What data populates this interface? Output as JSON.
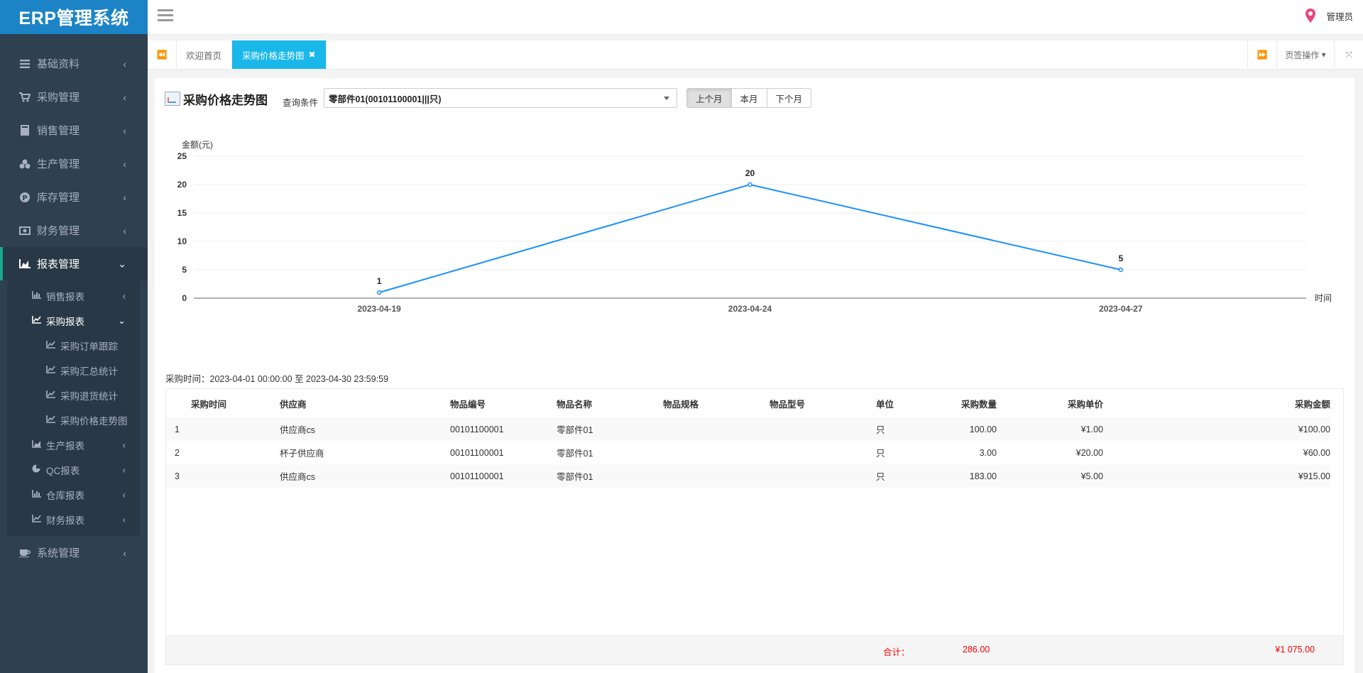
{
  "app": {
    "logo": "ERP管理系统",
    "user": "管理员"
  },
  "sidebar": {
    "items": [
      {
        "label": "基础资料",
        "icon": "list-icon"
      },
      {
        "label": "采购管理",
        "icon": "cart-icon"
      },
      {
        "label": "销售管理",
        "icon": "book-icon"
      },
      {
        "label": "生产管理",
        "icon": "cubes-icon"
      },
      {
        "label": "库存管理",
        "icon": "parking-icon"
      },
      {
        "label": "财务管理",
        "icon": "money-icon"
      },
      {
        "label": "报表管理",
        "icon": "area-chart-icon"
      }
    ],
    "report_submenu": [
      {
        "label": "销售报表",
        "icon": "bar-chart-icon"
      },
      {
        "label": "采购报表",
        "icon": "line-chart-icon"
      },
      {
        "label": "生产报表",
        "icon": "area-chart-icon"
      },
      {
        "label": "QC报表",
        "icon": "pie-chart-icon"
      },
      {
        "label": "仓库报表",
        "icon": "bar-chart-icon"
      },
      {
        "label": "财务报表",
        "icon": "line-chart-icon"
      }
    ],
    "purchase_reports": [
      {
        "label": "采购订单跟踪"
      },
      {
        "label": "采购汇总统计"
      },
      {
        "label": "采购退货统计"
      },
      {
        "label": "采购价格走势图"
      }
    ],
    "system": {
      "label": "系统管理",
      "icon": "coffee-icon"
    }
  },
  "tabs": {
    "items": [
      {
        "label": "欢迎首页"
      },
      {
        "label": "采购价格走势图"
      }
    ],
    "ops_label": "页签操作"
  },
  "page": {
    "title": "采购价格走势图",
    "query_label": "查询条件",
    "query_value": "零部件01(00101100001|||只)",
    "buttons": [
      "上个月",
      "本月",
      "下个月"
    ],
    "period": "采购时间：2023-04-01 00:00:00 至 2023-04-30 23:59:59"
  },
  "chart_data": {
    "type": "line",
    "ylabel": "金额(元)",
    "xlabel": "时间",
    "ylim": [
      0,
      25
    ],
    "yticks": [
      "0",
      "5",
      "10",
      "15",
      "20",
      "25"
    ],
    "categories": [
      "2023-04-19",
      "2023-04-24",
      "2023-04-27"
    ],
    "series": [
      {
        "values": [
          1,
          20,
          5
        ],
        "color": "#1890ff"
      }
    ],
    "data_labels": [
      "1",
      "20",
      "5"
    ],
    "grid": true
  },
  "table": {
    "headers": [
      "采购时间",
      "供应商",
      "物品编号",
      "物品名称",
      "物品规格",
      "物品型号",
      "单位",
      "采购数量",
      "采购单价",
      "采购金额"
    ],
    "rows": [
      [
        "1",
        "供应商cs",
        "00101100001",
        "零部件01",
        "",
        "",
        "只",
        "100.00",
        "¥1.00",
        "¥100.00"
      ],
      [
        "2",
        "杯子供应商",
        "00101100001",
        "零部件01",
        "",
        "",
        "只",
        "3.00",
        "¥20.00",
        "¥60.00"
      ],
      [
        "3",
        "供应商cs",
        "00101100001",
        "零部件01",
        "",
        "",
        "只",
        "183.00",
        "¥5.00",
        "¥915.00"
      ]
    ],
    "footer": {
      "label": "合计：",
      "quantity": "286.00",
      "amount": "¥1 075.00"
    }
  }
}
